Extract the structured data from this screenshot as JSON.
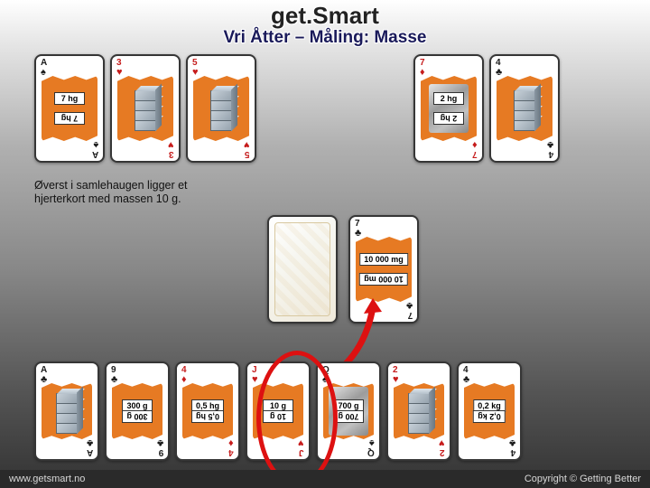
{
  "header": {
    "title": "get.Smart",
    "subtitle": "Vri Åtter – Måling: Masse"
  },
  "explain_text": "Øverst i samlehaugen ligger et hjerterkort med massen 10 g.",
  "rows": {
    "top": [
      {
        "rank": "A",
        "suit": "♠",
        "color": "black",
        "face": "value",
        "top_label": "7 hg",
        "bot_label": "7 hg"
      },
      {
        "rank": "3",
        "suit": "♥",
        "color": "red",
        "face": "cubes"
      },
      {
        "rank": "5",
        "suit": "♥",
        "color": "red",
        "face": "cubes"
      },
      {
        "empty": true
      },
      {
        "empty": true
      },
      {
        "rank": "7",
        "suit": "♦",
        "color": "red",
        "face": "value",
        "top_label": "2 hg",
        "bot_label": "2 hg",
        "photo": true
      },
      {
        "rank": "4",
        "suit": "♣",
        "color": "black",
        "face": "cubes"
      }
    ],
    "mid": [
      {
        "back": true
      },
      {
        "rank": "7",
        "suit": "♣",
        "color": "black",
        "face": "value",
        "top_label": "10 000 mg",
        "bot_label": "10 000 mg"
      }
    ],
    "bot": [
      {
        "rank": "A",
        "suit": "♣",
        "color": "black",
        "face": "cubes"
      },
      {
        "rank": "9",
        "suit": "♣",
        "color": "black",
        "face": "value",
        "top_label": "300 g",
        "bot_label": "300 g"
      },
      {
        "rank": "4",
        "suit": "♦",
        "color": "red",
        "face": "value",
        "top_label": "0,5 hg",
        "bot_label": "0,5 hg"
      },
      {
        "rank": "J",
        "suit": "♥",
        "color": "red",
        "face": "value",
        "top_label": "10 g",
        "bot_label": "10 g"
      },
      {
        "rank": "Q",
        "suit": "♠",
        "color": "black",
        "face": "value",
        "top_label": "700 g",
        "bot_label": "700 g",
        "photo": true
      },
      {
        "rank": "2",
        "suit": "♥",
        "color": "red",
        "face": "cubes"
      },
      {
        "rank": "4",
        "suit": "♣",
        "color": "black",
        "face": "value",
        "top_label": "0,2 kg",
        "bot_label": "0,2 kg"
      }
    ]
  },
  "highlight_index": 3,
  "footer": {
    "left": "www.getsmart.no",
    "right": "Copyright © Getting Better"
  }
}
